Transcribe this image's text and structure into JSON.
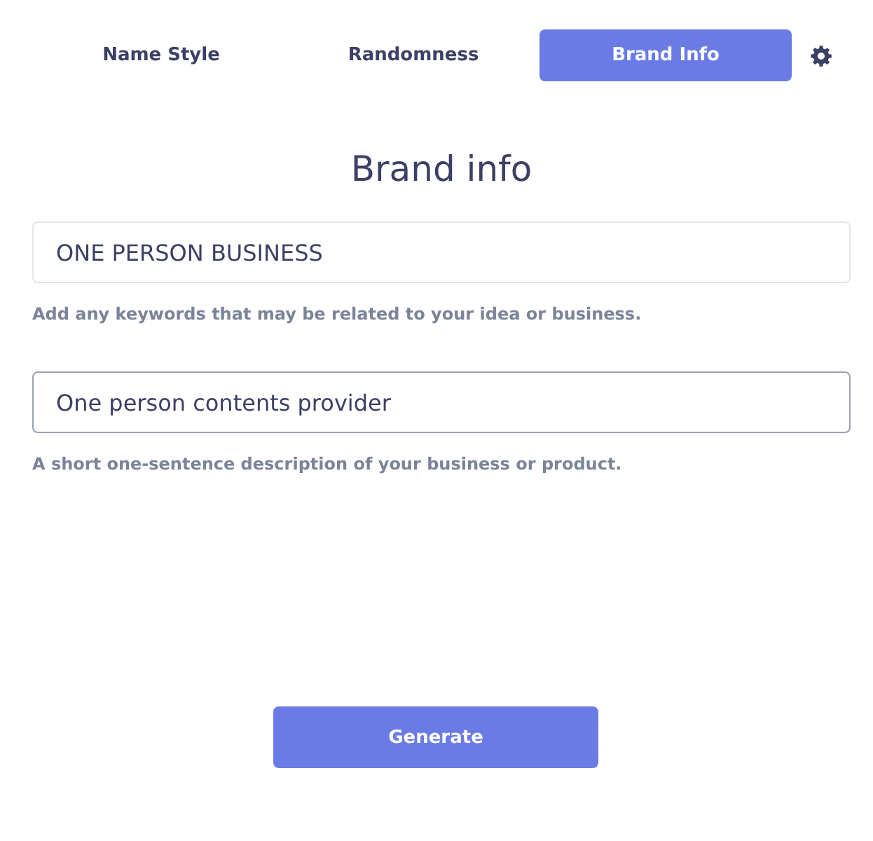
{
  "tabs": [
    {
      "label": "Name Style",
      "selected": false
    },
    {
      "label": "Randomness",
      "selected": false
    },
    {
      "label": "Brand Info",
      "selected": true
    }
  ],
  "heading": "Brand info",
  "fields": [
    {
      "value": "ONE PERSON BUSINESS",
      "focused": false,
      "hint": "Add any keywords that may be related to your idea or business."
    },
    {
      "value": "One person contents provider",
      "focused": true,
      "hint": "A short one-sentence description of your business or product."
    }
  ],
  "button": "Generate"
}
